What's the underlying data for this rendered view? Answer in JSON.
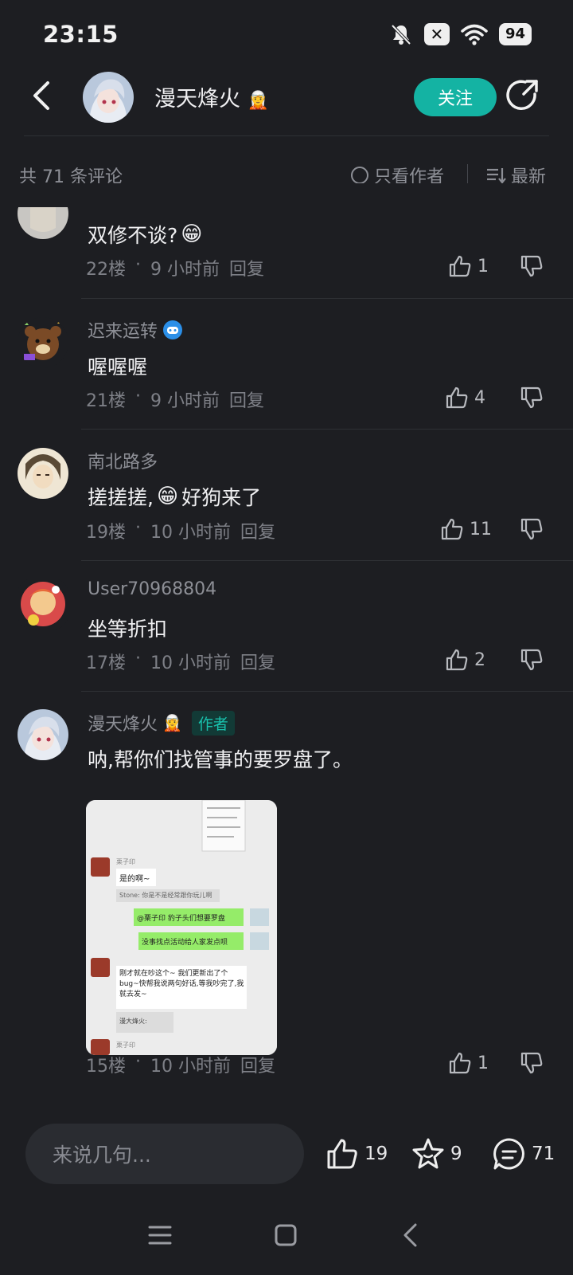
{
  "status_bar": {
    "time": "23:15",
    "battery": "94"
  },
  "header": {
    "title": "漫天烽火",
    "follow_label": "关注"
  },
  "filter_bar": {
    "count_text": "共 71 条评论",
    "author_only_label": "只看作者",
    "sort_label": "最新"
  },
  "comments": [
    {
      "name": "",
      "text": "双修不谈?",
      "floor": "22楼",
      "time": "9 小时前",
      "reply": "回复",
      "likes": "1",
      "has_emoji": true
    },
    {
      "name": "迟来运转",
      "text": "喔喔喔",
      "floor": "21楼",
      "time": "9 小时前",
      "reply": "回复",
      "likes": "4"
    },
    {
      "name": "南北路多",
      "text_before": "搓搓搓,",
      "text_after": "好狗来了",
      "floor": "19楼",
      "time": "10 小时前",
      "reply": "回复",
      "likes": "11"
    },
    {
      "name": "User70968804",
      "text": "坐等折扣",
      "floor": "17楼",
      "time": "10 小时前",
      "reply": "回复",
      "likes": "2"
    },
    {
      "name": "漫天烽火",
      "author_tag": "作者",
      "text": "呐,帮你们找管事的要罗盘了。",
      "floor": "15楼",
      "time": "10 小时前",
      "reply": "回复",
      "likes": "1"
    }
  ],
  "screenshot_chat": {
    "sender1": "栗子印",
    "msg1": "是的啊~",
    "sys_msg": "Stone: 你是不是经常跟你玩儿啊",
    "msg2": "@栗子印 豹子头们想要罗盘",
    "msg3": "没事找点活动给人家发点呗",
    "msg4": "刚才就在吵这个~ 我们更新出了个bug~快帮我说两句好话,等我吵完了,我就去发~",
    "quote": "漫大烽火:",
    "sender2": "栗子印"
  },
  "bottom_bar": {
    "input_placeholder": "来说几句...",
    "likes": "19",
    "stars": "9",
    "comments": "71"
  },
  "colors": {
    "accent": "#14b3a3",
    "background": "#1d1e22",
    "muted_text": "#8d8f96"
  }
}
